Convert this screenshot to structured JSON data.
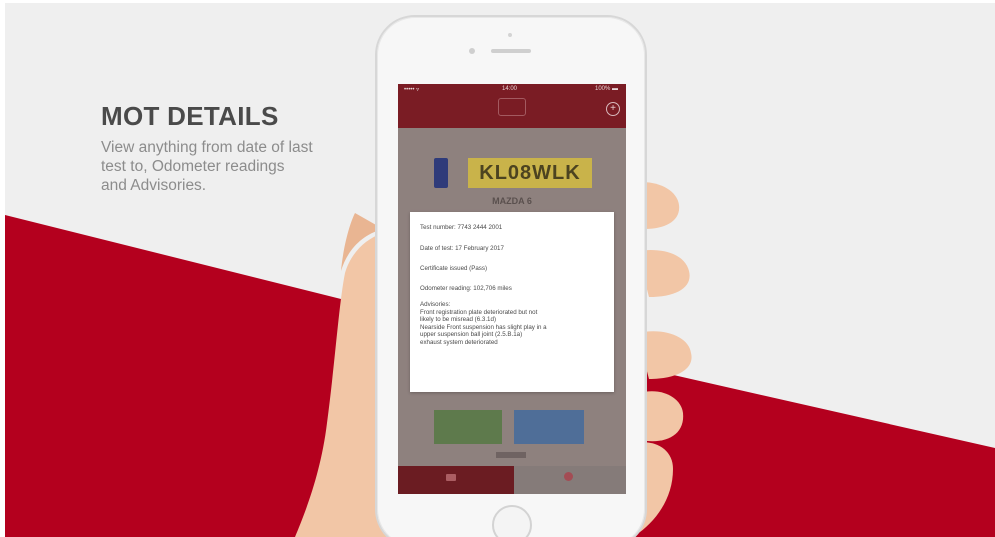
{
  "headline": {
    "title": "MOT DETAILS",
    "subtitle_lines": [
      "View anything from date of last",
      "test to, Odometer readings",
      "and Advisories."
    ]
  },
  "phone_status": {
    "carrier": "••••• ▿",
    "time": "14:00",
    "battery": "100% ▬"
  },
  "app": {
    "add_icon": "+",
    "plate": "KL08WLK",
    "make_model": "MAZDA 6"
  },
  "popup": {
    "test_number": "Test number: 7743 2444 2001",
    "date_of_test": "Date of test: 17 February 2017",
    "certificate": "Certificate issued (Pass)",
    "odometer": "Odometer reading: 102,706 miles",
    "advisories_title": "Advisories:",
    "advisories": [
      "Front registration plate deteriorated but not",
      "likely to be misread (6.3.1d)",
      "Nearside Front suspension has slight play in a",
      "upper suspension ball joint (2.5.B.1a)",
      "exhaust system deteriorated"
    ]
  },
  "colors": {
    "brand_red": "#b4001e",
    "app_bar": "#7a1c24",
    "background": "#efefef",
    "skin": "#f2c6a6"
  }
}
